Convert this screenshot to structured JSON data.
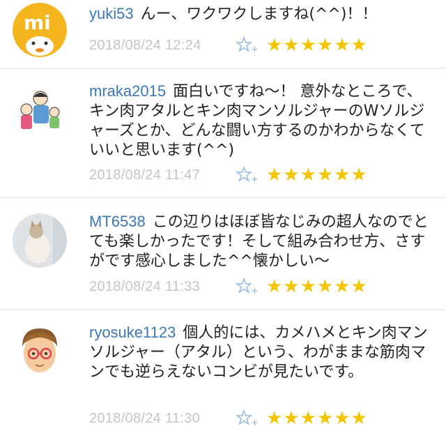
{
  "comments": [
    {
      "user": "yuki53",
      "text": "んー、ワクワクしますね(^^)！！",
      "date": "2018/08/24 12:24",
      "stars": "★★★★★★",
      "avatar": "mi-logo-avatar"
    },
    {
      "user": "mraka2015",
      "text": "面白いですね〜！ 意外なところで、キン肉アタルとキン肉マンソルジャーのWソルジャーズとか、どんな闘い方するのかわからなくていいと思います(^^)",
      "date": "2018/08/24 11:47",
      "stars": "★★★★★★",
      "avatar": "family-avatar"
    },
    {
      "user": "MT6538",
      "text": "この辺りはほぼ皆なじみの超人なのでとても楽しかったです！そして組み合わせ方、さすがです感心しました^^懐かしい〜",
      "date": "2018/08/24 11:33",
      "stars": "★★★★★★",
      "avatar": "cat-avatar"
    },
    {
      "user": "ryosuke1123",
      "text": "個人的には、カメハメとキン肉マンソルジャー（アタル）という、わがままな筋肉マンでも逆らえないコンビが見たいです。",
      "date": "2018/08/24 11:30",
      "stars": "★★★★★★",
      "avatar": "person-glasses-avatar"
    }
  ]
}
